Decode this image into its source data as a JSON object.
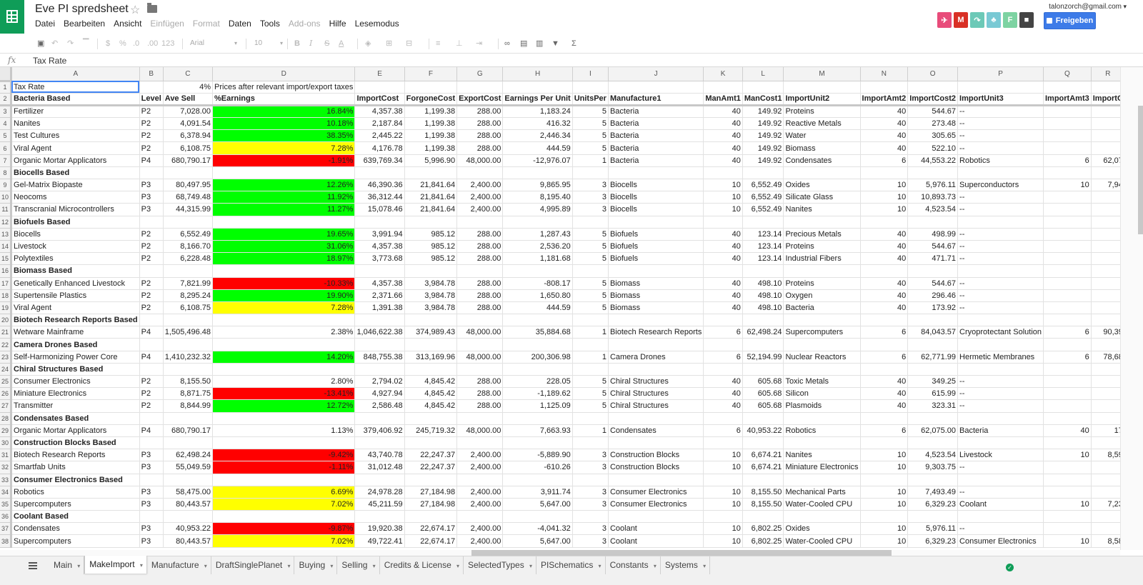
{
  "header": {
    "title": "Eve PI spredsheet",
    "user_email": "talonzorch@gmail.com",
    "share_label": "Freigeben",
    "addon_icons": [
      {
        "name": "plane-addon-icon",
        "color": "#e84c7a",
        "glyph": "✈"
      },
      {
        "name": "gmail-addon-icon",
        "color": "#d93025",
        "glyph": "M"
      },
      {
        "name": "share-addon-icon",
        "color": "#6cc9b7",
        "glyph": "↷"
      },
      {
        "name": "cat-addon-icon",
        "color": "#79c9d4",
        "glyph": "♣"
      },
      {
        "name": "f-addon-icon",
        "color": "#7dd3a2",
        "glyph": "F"
      },
      {
        "name": "comment-icon",
        "color": "#444444",
        "glyph": "■"
      }
    ]
  },
  "menu": [
    {
      "label": "Datei",
      "disabled": false
    },
    {
      "label": "Bearbeiten",
      "disabled": false
    },
    {
      "label": "Ansicht",
      "disabled": false
    },
    {
      "label": "Einfügen",
      "disabled": true
    },
    {
      "label": "Format",
      "disabled": true
    },
    {
      "label": "Daten",
      "disabled": false
    },
    {
      "label": "Tools",
      "disabled": false
    },
    {
      "label": "Add-ons",
      "disabled": true
    },
    {
      "label": "Hilfe",
      "disabled": false
    },
    {
      "label": "Lesemodus",
      "disabled": false
    }
  ],
  "toolbar": {
    "currency": "$",
    "percent": "%",
    "dec_less": ".0",
    "dec_more": ".00",
    "more_formats": "123",
    "font": "Arial",
    "font_size": "10",
    "bold": "B",
    "italic": "I",
    "strike": "S",
    "text_color": "A",
    "sigma": "Σ"
  },
  "formula_bar": {
    "fx": "fx",
    "content": "Tax Rate"
  },
  "columns": [
    "A",
    "B",
    "C",
    "D",
    "E",
    "F",
    "G",
    "H",
    "I",
    "J",
    "K",
    "L",
    "M",
    "N",
    "O",
    "P",
    "Q",
    "R"
  ],
  "rows": [
    {
      "num": "1",
      "cells": [
        "Tax Rate",
        "",
        "4%",
        "Prices after relevant import/export taxes",
        "",
        "",
        "",
        "",
        "",
        "",
        "",
        "",
        "",
        "",
        "",
        "",
        "",
        ""
      ]
    },
    {
      "num": "2",
      "cells": [
        "Bacteria Based",
        "Level",
        "Ave Sell",
        "%Earnings",
        "ImportCost",
        "ForgoneCost",
        "ExportCost",
        "Earnings Per Unit",
        "UnitsPer",
        "Manufacture1",
        "ManAmt1",
        "ManCost1",
        "ImportUnit2",
        "ImportAmt2",
        "ImportCost2",
        "ImportUnit3",
        "ImportAmt3",
        "ImportC"
      ]
    },
    {
      "num": "3",
      "cells": [
        "Fertilizer",
        "P2",
        "7,028.00",
        "16.84%",
        "4,357.38",
        "1,199.38",
        "288.00",
        "1,183.24",
        "5",
        "Bacteria",
        "40",
        "149.92",
        "Proteins",
        "40",
        "544.67",
        "--",
        "",
        ""
      ],
      "earn": "green"
    },
    {
      "num": "4",
      "cells": [
        "Nanites",
        "P2",
        "4,091.54",
        "10.18%",
        "2,187.84",
        "1,199.38",
        "288.00",
        "416.32",
        "5",
        "Bacteria",
        "40",
        "149.92",
        "Reactive Metals",
        "40",
        "273.48",
        "--",
        "",
        ""
      ],
      "earn": "green"
    },
    {
      "num": "5",
      "cells": [
        "Test Cultures",
        "P2",
        "6,378.94",
        "38.35%",
        "2,445.22",
        "1,199.38",
        "288.00",
        "2,446.34",
        "5",
        "Bacteria",
        "40",
        "149.92",
        "Water",
        "40",
        "305.65",
        "--",
        "",
        ""
      ],
      "earn": "green"
    },
    {
      "num": "6",
      "cells": [
        "Viral Agent",
        "P2",
        "6,108.75",
        "7.28%",
        "4,176.78",
        "1,199.38",
        "288.00",
        "444.59",
        "5",
        "Bacteria",
        "40",
        "149.92",
        "Biomass",
        "40",
        "522.10",
        "--",
        "",
        ""
      ],
      "earn": "yellow"
    },
    {
      "num": "7",
      "cells": [
        "Organic Mortar Applicators",
        "P4",
        "680,790.17",
        "-1.91%",
        "639,769.34",
        "5,996.90",
        "48,000.00",
        "-12,976.07",
        "1",
        "Bacteria",
        "40",
        "149.92",
        "Condensates",
        "6",
        "44,553.22",
        "Robotics",
        "6",
        "62,07"
      ],
      "earn": "red"
    },
    {
      "num": "8",
      "cells": [
        "Biocells Based",
        "",
        "",
        "",
        "",
        "",
        "",
        "",
        "",
        "",
        "",
        "",
        "",
        "",
        "",
        "",
        "",
        ""
      ],
      "section": true
    },
    {
      "num": "9",
      "cells": [
        "Gel-Matrix Biopaste",
        "P3",
        "80,497.95",
        "12.26%",
        "46,390.36",
        "21,841.64",
        "2,400.00",
        "9,865.95",
        "3",
        "Biocells",
        "10",
        "6,552.49",
        "Oxides",
        "10",
        "5,976.11",
        "Superconductors",
        "10",
        "7,94"
      ],
      "earn": "green"
    },
    {
      "num": "10",
      "cells": [
        "Neocoms",
        "P3",
        "68,749.48",
        "11.92%",
        "36,312.44",
        "21,841.64",
        "2,400.00",
        "8,195.40",
        "3",
        "Biocells",
        "10",
        "6,552.49",
        "Silicate Glass",
        "10",
        "10,893.73",
        "--",
        "",
        ""
      ],
      "earn": "green"
    },
    {
      "num": "11",
      "cells": [
        "Transcranial Microcontrollers",
        "P3",
        "44,315.99",
        "11.27%",
        "15,078.46",
        "21,841.64",
        "2,400.00",
        "4,995.89",
        "3",
        "Biocells",
        "10",
        "6,552.49",
        "Nanites",
        "10",
        "4,523.54",
        "--",
        "",
        ""
      ],
      "earn": "green"
    },
    {
      "num": "12",
      "cells": [
        "Biofuels Based",
        "",
        "",
        "",
        "",
        "",
        "",
        "",
        "",
        "",
        "",
        "",
        "",
        "",
        "",
        "",
        "",
        ""
      ],
      "section": true
    },
    {
      "num": "13",
      "cells": [
        "Biocells",
        "P2",
        "6,552.49",
        "19.65%",
        "3,991.94",
        "985.12",
        "288.00",
        "1,287.43",
        "5",
        "Biofuels",
        "40",
        "123.14",
        "Precious Metals",
        "40",
        "498.99",
        "--",
        "",
        ""
      ],
      "earn": "green"
    },
    {
      "num": "14",
      "cells": [
        "Livestock",
        "P2",
        "8,166.70",
        "31.06%",
        "4,357.38",
        "985.12",
        "288.00",
        "2,536.20",
        "5",
        "Biofuels",
        "40",
        "123.14",
        "Proteins",
        "40",
        "544.67",
        "--",
        "",
        ""
      ],
      "earn": "green"
    },
    {
      "num": "15",
      "cells": [
        "Polytextiles",
        "P2",
        "6,228.48",
        "18.97%",
        "3,773.68",
        "985.12",
        "288.00",
        "1,181.68",
        "5",
        "Biofuels",
        "40",
        "123.14",
        "Industrial Fibers",
        "40",
        "471.71",
        "--",
        "",
        ""
      ],
      "earn": "green"
    },
    {
      "num": "16",
      "cells": [
        "Biomass Based",
        "",
        "",
        "",
        "",
        "",
        "",
        "",
        "",
        "",
        "",
        "",
        "",
        "",
        "",
        "",
        "",
        ""
      ],
      "section": true
    },
    {
      "num": "17",
      "cells": [
        "Genetically Enhanced Livestock",
        "P2",
        "7,821.99",
        "-10.33%",
        "4,357.38",
        "3,984.78",
        "288.00",
        "-808.17",
        "5",
        "Biomass",
        "40",
        "498.10",
        "Proteins",
        "40",
        "544.67",
        "--",
        "",
        ""
      ],
      "earn": "red"
    },
    {
      "num": "18",
      "cells": [
        "Supertensile Plastics",
        "P2",
        "8,295.24",
        "19.90%",
        "2,371.66",
        "3,984.78",
        "288.00",
        "1,650.80",
        "5",
        "Biomass",
        "40",
        "498.10",
        "Oxygen",
        "40",
        "296.46",
        "--",
        "",
        ""
      ],
      "earn": "green"
    },
    {
      "num": "19",
      "cells": [
        "Viral Agent",
        "P2",
        "6,108.75",
        "7.28%",
        "1,391.38",
        "3,984.78",
        "288.00",
        "444.59",
        "5",
        "Biomass",
        "40",
        "498.10",
        "Bacteria",
        "40",
        "173.92",
        "--",
        "",
        ""
      ],
      "earn": "yellow"
    },
    {
      "num": "20",
      "cells": [
        "Biotech Research Reports Based",
        "",
        "",
        "",
        "",
        "",
        "",
        "",
        "",
        "",
        "",
        "",
        "",
        "",
        "",
        "",
        "",
        ""
      ],
      "section": true
    },
    {
      "num": "21",
      "cells": [
        "Wetware Mainframe",
        "P4",
        "1,505,496.48",
        "2.38%",
        "1,046,622.38",
        "374,989.43",
        "48,000.00",
        "35,884.68",
        "1",
        "Biotech Research Reports",
        "6",
        "62,498.24",
        "Supercomputers",
        "6",
        "84,043.57",
        "Cryoprotectant Solution",
        "6",
        "90,39"
      ]
    },
    {
      "num": "22",
      "cells": [
        "Camera Drones Based",
        "",
        "",
        "",
        "",
        "",
        "",
        "",
        "",
        "",
        "",
        "",
        "",
        "",
        "",
        "",
        "",
        ""
      ],
      "section": true
    },
    {
      "num": "23",
      "cells": [
        "Self-Harmonizing Power Core",
        "P4",
        "1,410,232.32",
        "14.20%",
        "848,755.38",
        "313,169.96",
        "48,000.00",
        "200,306.98",
        "1",
        "Camera Drones",
        "6",
        "52,194.99",
        "Nuclear Reactors",
        "6",
        "62,771.99",
        "Hermetic Membranes",
        "6",
        "78,68"
      ],
      "earn": "green"
    },
    {
      "num": "24",
      "cells": [
        "Chiral Structures Based",
        "",
        "",
        "",
        "",
        "",
        "",
        "",
        "",
        "",
        "",
        "",
        "",
        "",
        "",
        "",
        "",
        ""
      ],
      "section": true
    },
    {
      "num": "25",
      "cells": [
        "Consumer Electronics",
        "P2",
        "8,155.50",
        "2.80%",
        "2,794.02",
        "4,845.42",
        "288.00",
        "228.05",
        "5",
        "Chiral Structures",
        "40",
        "605.68",
        "Toxic Metals",
        "40",
        "349.25",
        "--",
        "",
        ""
      ]
    },
    {
      "num": "26",
      "cells": [
        "Miniature Electronics",
        "P2",
        "8,871.75",
        "-13.41%",
        "4,927.94",
        "4,845.42",
        "288.00",
        "-1,189.62",
        "5",
        "Chiral Structures",
        "40",
        "605.68",
        "Silicon",
        "40",
        "615.99",
        "--",
        "",
        ""
      ],
      "earn": "red"
    },
    {
      "num": "27",
      "cells": [
        "Transmitter",
        "P2",
        "8,844.99",
        "12.72%",
        "2,586.48",
        "4,845.42",
        "288.00",
        "1,125.09",
        "5",
        "Chiral Structures",
        "40",
        "605.68",
        "Plasmoids",
        "40",
        "323.31",
        "--",
        "",
        ""
      ],
      "earn": "green"
    },
    {
      "num": "28",
      "cells": [
        "Condensates Based",
        "",
        "",
        "",
        "",
        "",
        "",
        "",
        "",
        "",
        "",
        "",
        "",
        "",
        "",
        "",
        "",
        ""
      ],
      "section": true
    },
    {
      "num": "29",
      "cells": [
        "Organic Mortar Applicators",
        "P4",
        "680,790.17",
        "1.13%",
        "379,406.92",
        "245,719.32",
        "48,000.00",
        "7,663.93",
        "1",
        "Condensates",
        "6",
        "40,953.22",
        "Robotics",
        "6",
        "62,075.00",
        "Bacteria",
        "40",
        "17"
      ]
    },
    {
      "num": "30",
      "cells": [
        "Construction Blocks Based",
        "",
        "",
        "",
        "",
        "",
        "",
        "",
        "",
        "",
        "",
        "",
        "",
        "",
        "",
        "",
        "",
        ""
      ],
      "section": true
    },
    {
      "num": "31",
      "cells": [
        "Biotech Research Reports",
        "P3",
        "62,498.24",
        "-9.42%",
        "43,740.78",
        "22,247.37",
        "2,400.00",
        "-5,889.90",
        "3",
        "Construction Blocks",
        "10",
        "6,674.21",
        "Nanites",
        "10",
        "4,523.54",
        "Livestock",
        "10",
        "8,59"
      ],
      "earn": "red"
    },
    {
      "num": "32",
      "cells": [
        "Smartfab Units",
        "P3",
        "55,049.59",
        "-1.11%",
        "31,012.48",
        "22,247.37",
        "2,400.00",
        "-610.26",
        "3",
        "Construction Blocks",
        "10",
        "6,674.21",
        "Miniature Electronics",
        "10",
        "9,303.75",
        "--",
        "",
        ""
      ],
      "earn": "red"
    },
    {
      "num": "33",
      "cells": [
        "Consumer Electronics Based",
        "",
        "",
        "",
        "",
        "",
        "",
        "",
        "",
        "",
        "",
        "",
        "",
        "",
        "",
        "",
        "",
        ""
      ],
      "section": true
    },
    {
      "num": "34",
      "cells": [
        "Robotics",
        "P3",
        "58,475.00",
        "6.69%",
        "24,978.28",
        "27,184.98",
        "2,400.00",
        "3,911.74",
        "3",
        "Consumer Electronics",
        "10",
        "8,155.50",
        "Mechanical Parts",
        "10",
        "7,493.49",
        "--",
        "",
        ""
      ],
      "earn": "yellow"
    },
    {
      "num": "35",
      "cells": [
        "Supercomputers",
        "P3",
        "80,443.57",
        "7.02%",
        "45,211.59",
        "27,184.98",
        "2,400.00",
        "5,647.00",
        "3",
        "Consumer Electronics",
        "10",
        "8,155.50",
        "Water-Cooled CPU",
        "10",
        "6,329.23",
        "Coolant",
        "10",
        "7,23"
      ],
      "earn": "yellow"
    },
    {
      "num": "36",
      "cells": [
        "Coolant Based",
        "",
        "",
        "",
        "",
        "",
        "",
        "",
        "",
        "",
        "",
        "",
        "",
        "",
        "",
        "",
        "",
        ""
      ],
      "section": true
    },
    {
      "num": "37",
      "cells": [
        "Condensates",
        "P3",
        "40,953.22",
        "-9.87%",
        "19,920.38",
        "22,674.17",
        "2,400.00",
        "-4,041.32",
        "3",
        "Coolant",
        "10",
        "6,802.25",
        "Oxides",
        "10",
        "5,976.11",
        "--",
        "",
        ""
      ],
      "earn": "red"
    },
    {
      "num": "38",
      "cells": [
        "Supercomputers",
        "P3",
        "80,443.57",
        "7.02%",
        "49,722.41",
        "22,674.17",
        "2,400.00",
        "5,647.00",
        "3",
        "Coolant",
        "10",
        "6,802.25",
        "Water-Cooled CPU",
        "10",
        "6,329.23",
        "Consumer Electronics",
        "10",
        "8,58"
      ],
      "earn": "yellow"
    }
  ],
  "sheet_tabs": [
    {
      "label": "Main",
      "active": false
    },
    {
      "label": "MakeImport",
      "active": true
    },
    {
      "label": "Manufacture",
      "active": false
    },
    {
      "label": "DraftSinglePlanet",
      "active": false
    },
    {
      "label": "Buying",
      "active": false
    },
    {
      "label": "Selling",
      "active": false
    },
    {
      "label": "Credits & License",
      "active": false
    },
    {
      "label": "SelectedTypes",
      "active": false
    },
    {
      "label": "PISchematics",
      "active": false
    },
    {
      "label": "Constants",
      "active": false
    },
    {
      "label": "Systems",
      "active": false
    }
  ],
  "colors": {
    "green": "#00ff00",
    "yellow": "#ffff00",
    "red": "#ff0000",
    "brand": "#0f9d58",
    "share": "#3d7be8"
  }
}
